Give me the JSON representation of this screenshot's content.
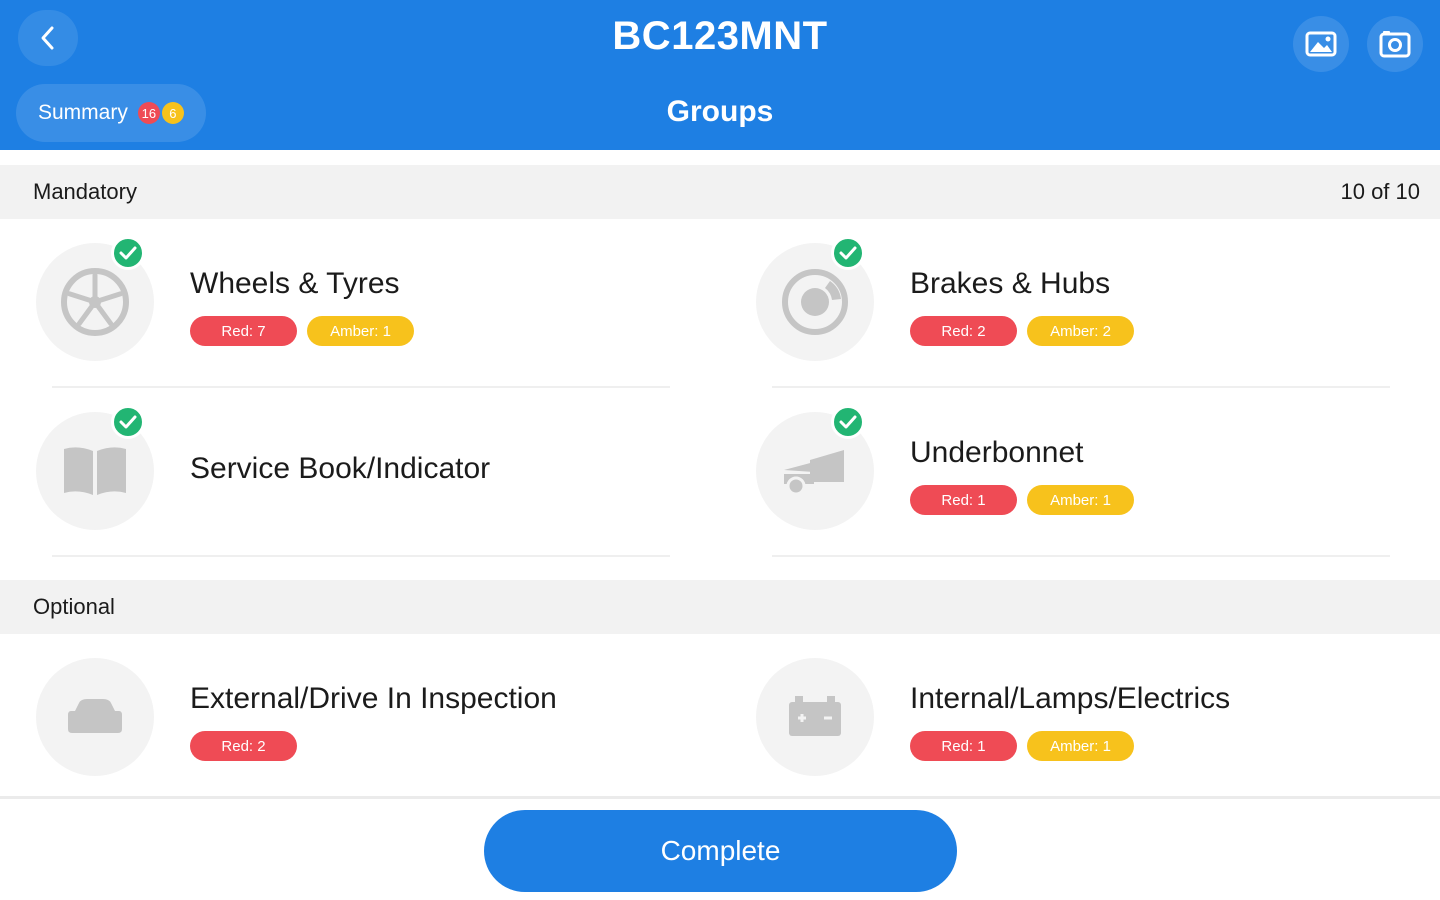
{
  "header": {
    "title": "BC123MNT",
    "subtitle": "Groups",
    "summary": {
      "label": "Summary",
      "red_count": "16",
      "amber_count": "6"
    }
  },
  "sections": [
    {
      "label": "Mandatory",
      "count": "10 of 10"
    },
    {
      "label": "Optional",
      "count": ""
    }
  ],
  "groups": [
    {
      "name": "Wheels & Tyres",
      "red": "Red: 7",
      "amber": "Amber: 1",
      "icon": "wheel-icon",
      "completed": true
    },
    {
      "name": "Brakes & Hubs",
      "red": "Red: 2",
      "amber": "Amber: 2",
      "icon": "brake-disc-icon",
      "completed": true
    },
    {
      "name": "Service Book/Indicator",
      "icon": "book-icon",
      "completed": true
    },
    {
      "name": "Underbonnet",
      "red": "Red: 1",
      "amber": "Amber: 1",
      "icon": "open-bonnet-car-icon",
      "completed": true
    },
    {
      "name": "External/Drive In Inspection",
      "red": "Red: 2",
      "icon": "car-icon",
      "completed": false
    },
    {
      "name": "Internal/Lamps/Electrics",
      "red": "Red: 1",
      "amber": "Amber: 1",
      "icon": "battery-icon",
      "completed": false
    }
  ],
  "footer": {
    "complete_label": "Complete"
  },
  "colors": {
    "primary": "#1e7fe3",
    "red": "#ef4b55",
    "amber": "#f7c21c",
    "check": "#22b573"
  }
}
